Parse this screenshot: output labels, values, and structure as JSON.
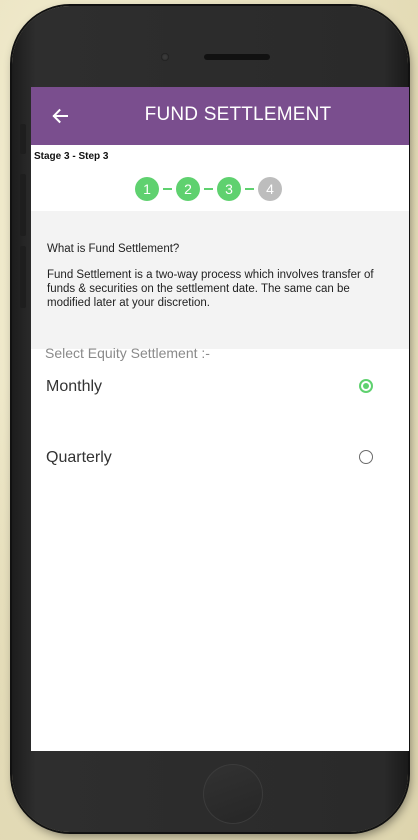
{
  "header": {
    "title": "FUND SETTLEMENT"
  },
  "progress": {
    "stage_label": "Stage 3 - Step 3",
    "steps": [
      {
        "label": "1",
        "status": "done"
      },
      {
        "label": "2",
        "status": "done"
      },
      {
        "label": "3",
        "status": "done"
      },
      {
        "label": "4",
        "status": "pending"
      }
    ]
  },
  "info": {
    "title": "What is Fund Settlement?",
    "body": "Fund Settlement is a two-way process which involves transfer of funds & securities on the settlement date. The same can be modified later at your discretion."
  },
  "settlement": {
    "label": "Select Equity Settlement :-",
    "options": [
      {
        "label": "Monthly",
        "selected": true
      },
      {
        "label": "Quarterly",
        "selected": false
      }
    ]
  },
  "colors": {
    "appbar": "#7a4e8e",
    "step_done": "#5fd16f",
    "step_pending": "#bdbdbd"
  },
  "icons": {
    "back": "arrow-left-icon"
  }
}
